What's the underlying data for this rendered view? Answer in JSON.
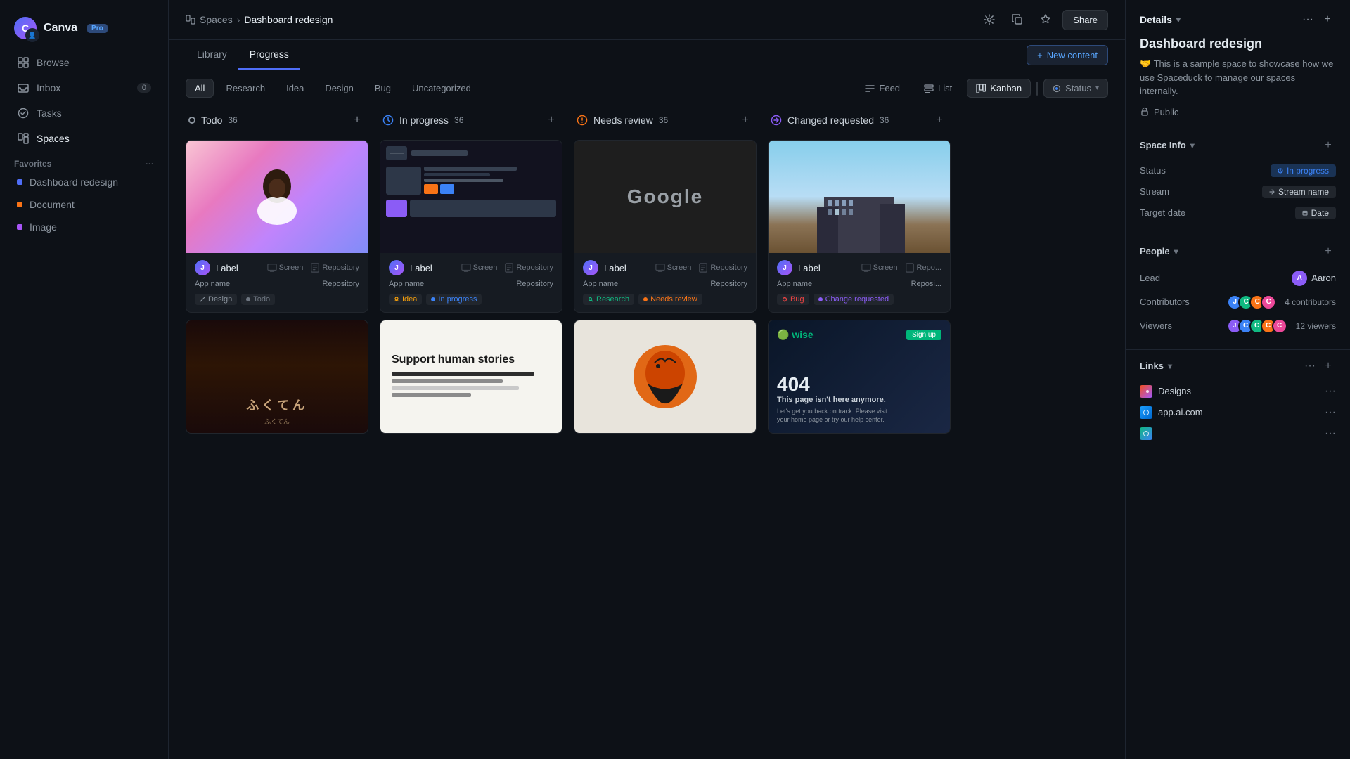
{
  "sidebar": {
    "app_name": "Canva",
    "pro_label": "Pro",
    "nav_items": [
      {
        "id": "browse",
        "label": "Browse",
        "icon": "browse-icon"
      },
      {
        "id": "inbox",
        "label": "Inbox",
        "icon": "inbox-icon",
        "badge": "0"
      },
      {
        "id": "tasks",
        "label": "Tasks",
        "icon": "tasks-icon"
      },
      {
        "id": "spaces",
        "label": "Spaces",
        "icon": "spaces-icon"
      }
    ],
    "favorites_label": "Favorites",
    "favorites_items": [
      {
        "id": "dashboard-redesign",
        "label": "Dashboard redesign",
        "color": "blue"
      },
      {
        "id": "document",
        "label": "Document",
        "color": "orange"
      },
      {
        "id": "image",
        "label": "Image",
        "color": "purple"
      }
    ]
  },
  "breadcrumb": {
    "spaces": "Spaces",
    "current": "Dashboard redesign"
  },
  "topbar": {
    "share_label": "Share"
  },
  "tabs": {
    "library": "Library",
    "progress": "Progress",
    "active": "progress"
  },
  "new_content_btn": "New content",
  "filters": {
    "all": "All",
    "research": "Research",
    "idea": "Idea",
    "design": "Design",
    "bug": "Bug",
    "uncategorized": "Uncategorized",
    "active": "all"
  },
  "view_controls": {
    "feed": "Feed",
    "list": "List",
    "kanban": "Kanban",
    "status": "Status",
    "active_view": "kanban"
  },
  "columns": [
    {
      "id": "todo",
      "title": "Todo",
      "count": 36,
      "dot_class": "dot-todo",
      "cards": [
        {
          "id": "card-1",
          "image_type": "portrait",
          "label": "Label",
          "app_name": "App name",
          "screen_icon": true,
          "screen_label": "Screen",
          "repo_label": "Repository",
          "tag": "Design",
          "tag_class": "tag-design",
          "status": "Todo",
          "status_class": "tag-todo"
        },
        {
          "id": "card-5",
          "image_type": "street"
        }
      ]
    },
    {
      "id": "inprogress",
      "title": "In progress",
      "count": 36,
      "dot_class": "dot-inprogress",
      "cards": [
        {
          "id": "card-2",
          "image_type": "darkui",
          "label": "Label",
          "app_name": "App name",
          "screen_label": "Screen",
          "repo_label": "Repository",
          "tag": "Idea",
          "tag_class": "tag-idea",
          "status": "In progress",
          "status_class": "tag-inprogress"
        },
        {
          "id": "card-6",
          "image_type": "support"
        }
      ]
    },
    {
      "id": "needsreview",
      "title": "Needs review",
      "count": 36,
      "dot_class": "dot-needsreview",
      "cards": [
        {
          "id": "card-3",
          "image_type": "google",
          "label": "Label",
          "app_name": "App name",
          "screen_label": "Screen",
          "repo_label": "Repository",
          "tag": "Research",
          "tag_class": "tag-research",
          "status": "Needs review",
          "status_class": "tag-needsreview"
        },
        {
          "id": "card-7",
          "image_type": "bird"
        }
      ]
    },
    {
      "id": "changed",
      "title": "Changed requested",
      "count": 36,
      "dot_class": "dot-changed",
      "cards": [
        {
          "id": "card-4",
          "image_type": "building",
          "label": "Label",
          "app_name": "App name",
          "screen_label": "Screen",
          "repo_label": "Repository",
          "tag": "Bug",
          "tag_class": "tag-bug",
          "status": "Change requested",
          "status_class": "tag-changed"
        },
        {
          "id": "card-8",
          "image_type": "404"
        }
      ]
    }
  ],
  "right_panel": {
    "details_label": "Details",
    "space_title": "Dashboard redesign",
    "description": "🤝 This is a sample space to showcase how we use Spaceduck to manage our spaces internally.",
    "public_label": "Public",
    "space_info_label": "Space Info",
    "fields": {
      "status_label": "Status",
      "status_value": "In progress",
      "stream_label": "Stream",
      "stream_value": "Stream name",
      "target_date_label": "Target date",
      "target_date_value": "Date"
    },
    "people_label": "People",
    "lead_label": "Lead",
    "lead_name": "Aaron",
    "contributors_label": "Contributors",
    "contributors_count": "4 contributors",
    "viewers_label": "Viewers",
    "viewers_count": "12 viewers",
    "links_label": "Links",
    "links": [
      {
        "id": "designs",
        "label": "Designs",
        "type": "figma"
      },
      {
        "id": "app-link",
        "label": "app.ai.com",
        "type": "web"
      },
      {
        "id": "link3",
        "label": "",
        "type": "web"
      }
    ]
  }
}
